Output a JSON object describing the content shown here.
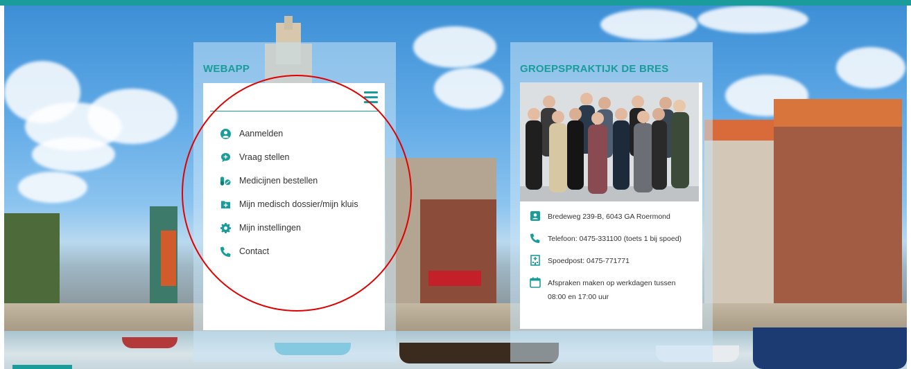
{
  "webapp": {
    "title": "WEBAPP",
    "menu": [
      {
        "label": "Aanmelden",
        "icon": "user-circle-icon"
      },
      {
        "label": "Vraag stellen",
        "icon": "chat-bubble-plus-icon"
      },
      {
        "label": "Medicijnen bestellen",
        "icon": "pills-icon"
      },
      {
        "label": "Mijn medisch dossier/mijn kluis",
        "icon": "medical-folder-icon"
      },
      {
        "label": "Mijn instellingen",
        "icon": "gear-icon"
      },
      {
        "label": "Contact",
        "icon": "phone-icon"
      }
    ]
  },
  "praktijk": {
    "title": "GROEPSPRAKTIJK DE BRES",
    "address": "Bredeweg 239-B, 6043 GA Roermond",
    "phone": "Telefoon: 0475-331100 (toets 1 bij spoed)",
    "emergency": "Spoedpost: 0475-771771",
    "appointments_line1": "Afspraken maken op werkdagen tussen",
    "appointments_line2": "08:00 en 17:00 uur"
  },
  "colors": {
    "accent": "#1a9c9a",
    "annotation": "#e00000"
  }
}
